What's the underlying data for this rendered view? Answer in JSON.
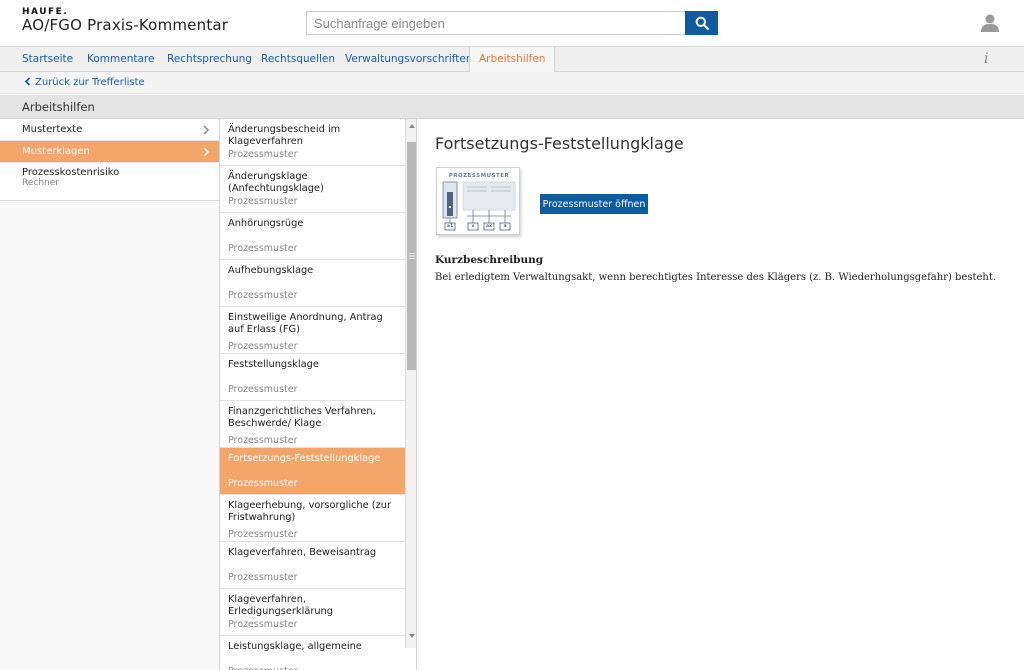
{
  "header": {
    "brand": "HAUFE.",
    "app_title": "AO/FGO Praxis-Kommentar",
    "search_placeholder": "Suchanfrage eingeben"
  },
  "nav": {
    "items": [
      {
        "label": "Startseite",
        "active": false
      },
      {
        "label": "Kommentare",
        "active": false
      },
      {
        "label": "Rechtsprechung",
        "active": false
      },
      {
        "label": "Rechtsquellen",
        "active": false
      },
      {
        "label": "Verwaltungsvorschriften",
        "active": false
      },
      {
        "label": "Arbeitshilfen",
        "active": true
      }
    ],
    "info_glyph": "i"
  },
  "back_link": "Zurück zur Trefferliste",
  "section_title": "Arbeitshilfen",
  "left_menu": [
    {
      "label": "Mustertexte",
      "active": false,
      "has_chevron": true
    },
    {
      "label": "Musterklagen",
      "active": true,
      "has_chevron": true
    },
    {
      "label": "Prozesskostenrisiko",
      "sub": "Rechner",
      "active": false,
      "has_chevron": false
    }
  ],
  "documents": [
    {
      "title": "Änderungsbescheid im Klageverfahren",
      "type": "Prozessmuster",
      "active": false
    },
    {
      "title": "Änderungsklage (Anfechtungsklage)",
      "type": "Prozessmuster",
      "active": false
    },
    {
      "title": "Anhörungsrüge",
      "type": "Prozessmuster",
      "active": false
    },
    {
      "title": "Aufhebungsklage",
      "type": "Prozessmuster",
      "active": false
    },
    {
      "title": "Einstweilige Anordnung, Antrag auf Erlass (FG)",
      "type": "Prozessmuster",
      "active": false
    },
    {
      "title": "Feststellungsklage",
      "type": "Prozessmuster",
      "active": false
    },
    {
      "title": "Finanzgerichtliches Verfahren, Beschwerde/ Klage",
      "type": "Prozessmuster",
      "active": false
    },
    {
      "title": "Fortsetzungs-Feststellungklage",
      "type": "Prozessmuster",
      "active": true
    },
    {
      "title": "Klageerhebung, vorsorgliche (zur Fristwahrung)",
      "type": "Prozessmuster",
      "active": false
    },
    {
      "title": "Klageverfahren, Beweisantrag",
      "type": "Prozessmuster",
      "active": false
    },
    {
      "title": "Klageverfahren, Erledigungserklärung",
      "type": "Prozessmuster",
      "active": false
    },
    {
      "title": "Leistungsklage, allgemeine",
      "type": "Prozessmuster",
      "active": false
    }
  ],
  "detail": {
    "title": "Fortsetzungs-Feststellungklage",
    "thumb_label": "PROZESSMUSTER",
    "thumb_boxes": [
      "a1",
      "x",
      "ax",
      "a"
    ],
    "open_button": "Prozessmuster öffnen",
    "summary_heading": "Kurzbeschreibung",
    "summary_text": "Bei erledigtem Verwaltungsakt, wenn berechtigtes Interesse des Klägers (z. B. Wiederholungsgefahr) besteht."
  },
  "colors": {
    "primary": "#0e5c9e",
    "accent": "#f4a56a",
    "active_nav": "#e8743b",
    "link": "#1a5fa0"
  }
}
